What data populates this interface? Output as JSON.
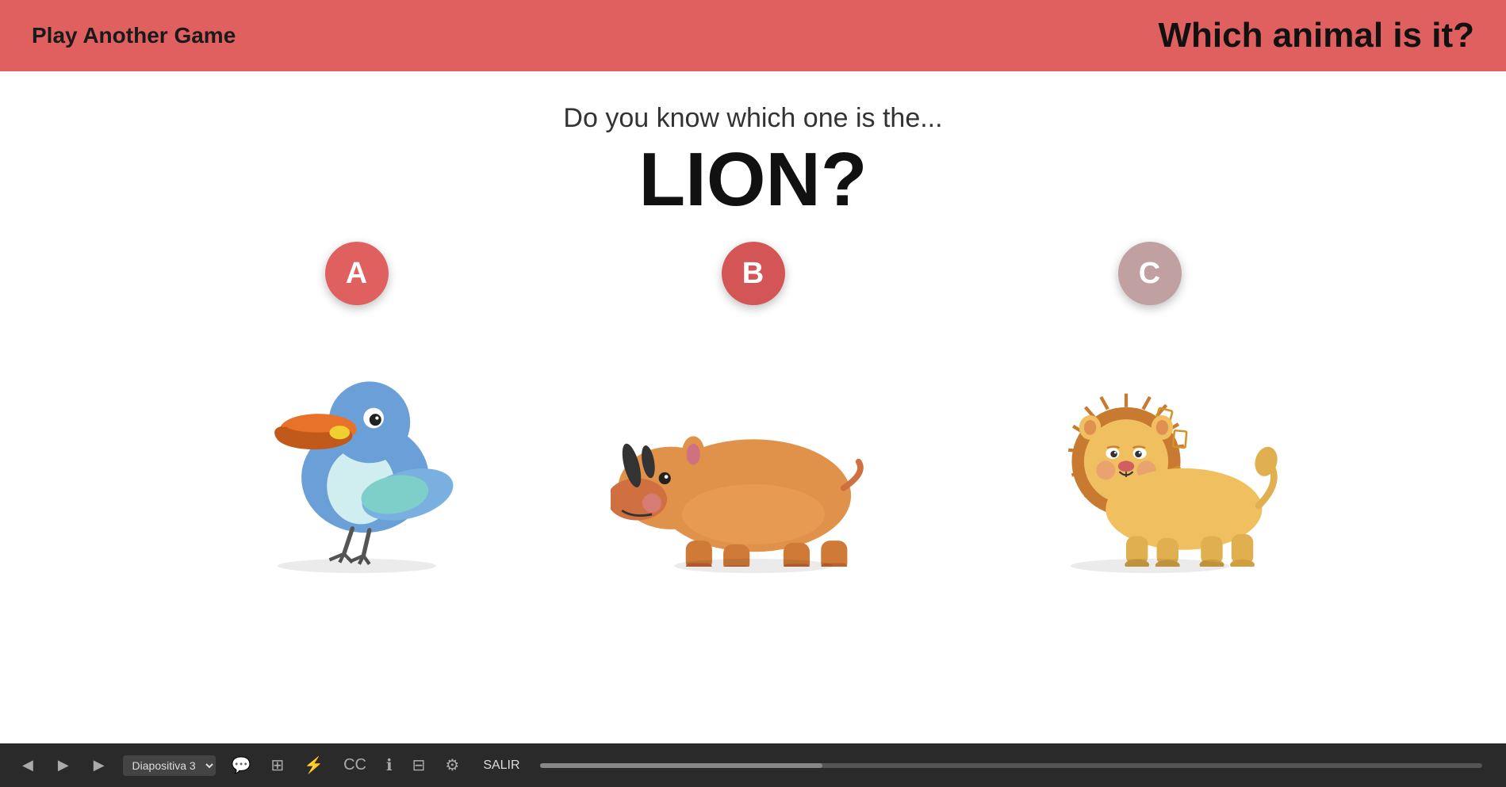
{
  "header": {
    "play_another_label": "Play Another Game",
    "game_title": "Which animal is it?",
    "bg_color": "#e06060"
  },
  "question": {
    "subtitle": "Do you know which one is the...",
    "animal_name": "LION?"
  },
  "choices": [
    {
      "id": "A",
      "label": "A",
      "badge_class": "badge-a",
      "animal": "toucan",
      "description": "Toucan bird"
    },
    {
      "id": "B",
      "label": "B",
      "badge_class": "badge-b",
      "animal": "rhino",
      "description": "Rhinoceros"
    },
    {
      "id": "C",
      "label": "C",
      "badge_class": "badge-c",
      "animal": "lion",
      "description": "Lion"
    }
  ],
  "toolbar": {
    "slide_label": "Diapositiva 3",
    "salir_label": "SALIR",
    "prev_icon": "◀",
    "play_icon": "▶",
    "next_icon": "▶"
  }
}
